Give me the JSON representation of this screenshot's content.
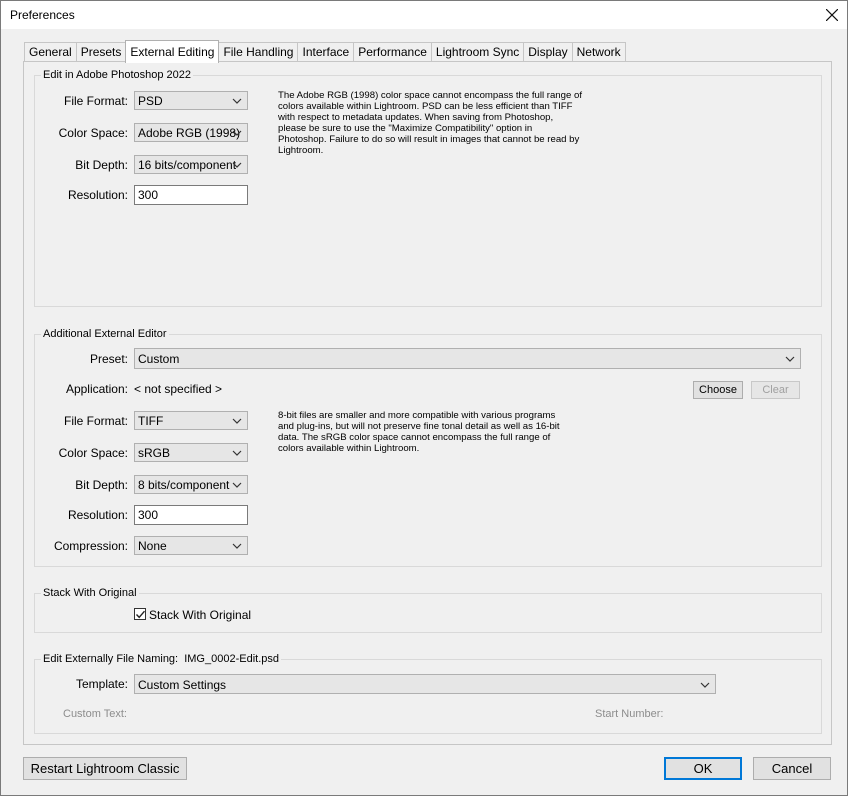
{
  "window": {
    "title": "Preferences"
  },
  "tabs": [
    {
      "label": "General"
    },
    {
      "label": "Presets"
    },
    {
      "label": "External Editing"
    },
    {
      "label": "File Handling"
    },
    {
      "label": "Interface"
    },
    {
      "label": "Performance"
    },
    {
      "label": "Lightroom Sync"
    },
    {
      "label": "Display"
    },
    {
      "label": "Network"
    }
  ],
  "photoshop": {
    "group_label": "Edit in Adobe Photoshop 2022",
    "file_format_label": "File Format:",
    "file_format_value": "PSD",
    "color_space_label": "Color Space:",
    "color_space_value": "Adobe RGB (1998)",
    "bit_depth_label": "Bit Depth:",
    "bit_depth_value": "16 bits/component",
    "resolution_label": "Resolution:",
    "resolution_value": "300",
    "note": "The Adobe RGB (1998) color space cannot encompass the full range of colors available within Lightroom. PSD can be less efficient than TIFF with respect to metadata updates. When saving from Photoshop, please be sure to use the \"Maximize Compatibility\" option in Photoshop. Failure to do so will result in images that cannot be read by Lightroom."
  },
  "additional": {
    "group_label": "Additional External Editor",
    "preset_label": "Preset:",
    "preset_value": "Custom",
    "application_label": "Application:",
    "application_value": "< not specified >",
    "choose_label": "Choose",
    "clear_label": "Clear",
    "file_format_label": "File Format:",
    "file_format_value": "TIFF",
    "color_space_label": "Color Space:",
    "color_space_value": "sRGB",
    "bit_depth_label": "Bit Depth:",
    "bit_depth_value": "8 bits/component",
    "resolution_label": "Resolution:",
    "resolution_value": "300",
    "compression_label": "Compression:",
    "compression_value": "None",
    "note": "8-bit files are smaller and more compatible with various programs and plug-ins, but will not preserve fine tonal detail as well as 16-bit data. The sRGB color space cannot encompass the full range of colors available within Lightroom."
  },
  "stack": {
    "group_label": "Stack With Original",
    "checkbox_label": "Stack With Original",
    "checked": true
  },
  "naming": {
    "group_label": "Edit Externally File Naming:  IMG_0002-Edit.psd",
    "template_label": "Template:",
    "template_value": "Custom Settings",
    "custom_text_label": "Custom Text:",
    "start_number_label": "Start Number:"
  },
  "footer": {
    "restart_label": "Restart Lightroom Classic",
    "ok_label": "OK",
    "cancel_label": "Cancel"
  },
  "colors": {
    "focus_accent": "#0078d7"
  }
}
